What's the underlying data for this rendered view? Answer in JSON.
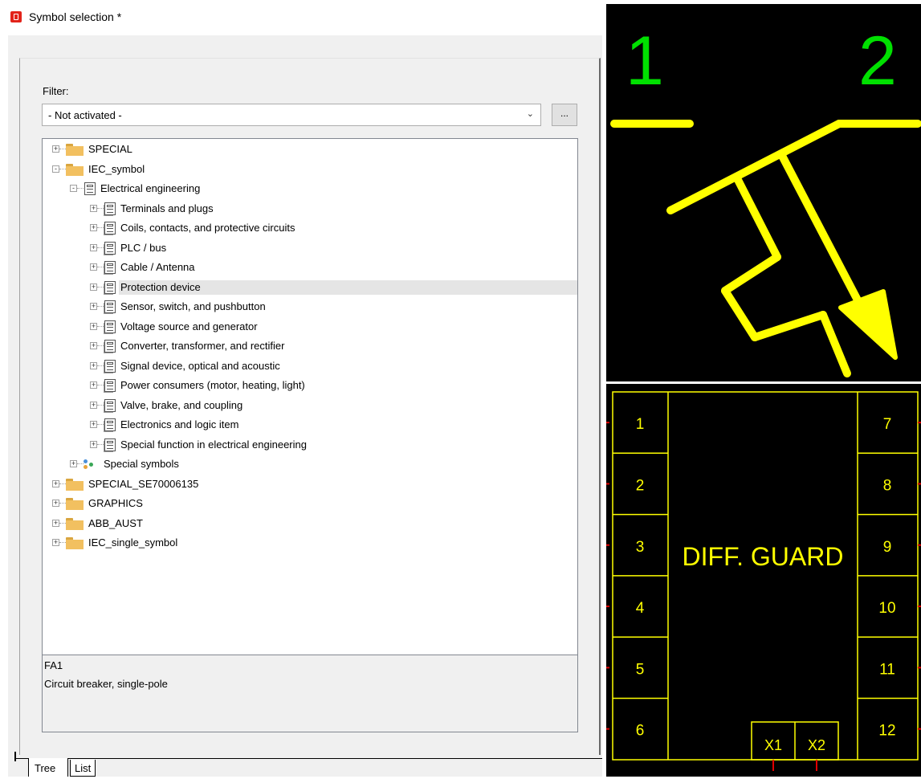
{
  "window": {
    "title": "Symbol selection *"
  },
  "filter": {
    "label": "Filter:",
    "value": "- Not activated -",
    "more_label": "..."
  },
  "tree": {
    "nodes": [
      {
        "label": "SPECIAL",
        "icon": "folder-icon",
        "level": 0,
        "expander": "+"
      },
      {
        "label": "IEC_symbol",
        "icon": "folder-icon",
        "level": 0,
        "expander": "-"
      },
      {
        "label": "Electrical engineering",
        "icon": "symbol-library-icon",
        "level": 1,
        "expander": "-"
      },
      {
        "label": "Terminals and plugs",
        "icon": "symbol-group-icon",
        "level": 2,
        "expander": "+"
      },
      {
        "label": "Coils, contacts, and protective circuits",
        "icon": "symbol-group-icon",
        "level": 2,
        "expander": "+"
      },
      {
        "label": "PLC / bus",
        "icon": "symbol-group-icon",
        "level": 2,
        "expander": "+"
      },
      {
        "label": "Cable / Antenna",
        "icon": "symbol-group-icon",
        "level": 2,
        "expander": "+"
      },
      {
        "label": "Protection device",
        "icon": "symbol-group-icon",
        "level": 2,
        "expander": "+",
        "selected": true
      },
      {
        "label": "Sensor, switch, and pushbutton",
        "icon": "symbol-group-icon",
        "level": 2,
        "expander": "+"
      },
      {
        "label": "Voltage source and generator",
        "icon": "symbol-group-icon",
        "level": 2,
        "expander": "+"
      },
      {
        "label": "Converter, transformer, and rectifier",
        "icon": "symbol-group-icon",
        "level": 2,
        "expander": "+"
      },
      {
        "label": "Signal device, optical and acoustic",
        "icon": "symbol-group-icon",
        "level": 2,
        "expander": "+"
      },
      {
        "label": "Power consumers (motor, heating, light)",
        "icon": "symbol-group-icon",
        "level": 2,
        "expander": "+"
      },
      {
        "label": "Valve, brake, and coupling",
        "icon": "symbol-group-icon",
        "level": 2,
        "expander": "+"
      },
      {
        "label": "Electronics and logic item",
        "icon": "symbol-group-icon",
        "level": 2,
        "expander": "+"
      },
      {
        "label": "Special function in electrical engineering",
        "icon": "symbol-group-icon",
        "level": 2,
        "expander": "+"
      },
      {
        "label": "Special symbols",
        "icon": "special-symbols-icon",
        "level": 1,
        "expander": "+"
      },
      {
        "label": "SPECIAL_SE70006135",
        "icon": "folder-icon",
        "level": 0,
        "expander": "+"
      },
      {
        "label": "GRAPHICS",
        "icon": "folder-icon",
        "level": 0,
        "expander": "+"
      },
      {
        "label": "ABB_AUST",
        "icon": "folder-icon",
        "level": 0,
        "expander": "+"
      },
      {
        "label": "IEC_single_symbol",
        "icon": "folder-icon",
        "level": 0,
        "expander": "+"
      }
    ]
  },
  "description": {
    "code": "FA1",
    "text": "Circuit breaker, single-pole"
  },
  "tabs": [
    {
      "label": "Tree",
      "active": true
    },
    {
      "label": "List",
      "active": false
    }
  ],
  "preview_symbol": {
    "pin_left": "1",
    "pin_right": "2",
    "pin_color": "#00e000",
    "line_color": "#ffff00"
  },
  "preview_block": {
    "title": "DIFF. GUARD",
    "left_pins": [
      "1",
      "2",
      "3",
      "4",
      "5",
      "6"
    ],
    "right_pins": [
      "7",
      "8",
      "9",
      "10",
      "11",
      "12"
    ],
    "bottom_pins": [
      "X1",
      "X2"
    ],
    "line_color": "#ffff00",
    "connector_color": "#e00000"
  },
  "colors": {
    "selection": "#e5e5e5",
    "panel": "#f0f0f0",
    "brand": "#e2231a"
  }
}
